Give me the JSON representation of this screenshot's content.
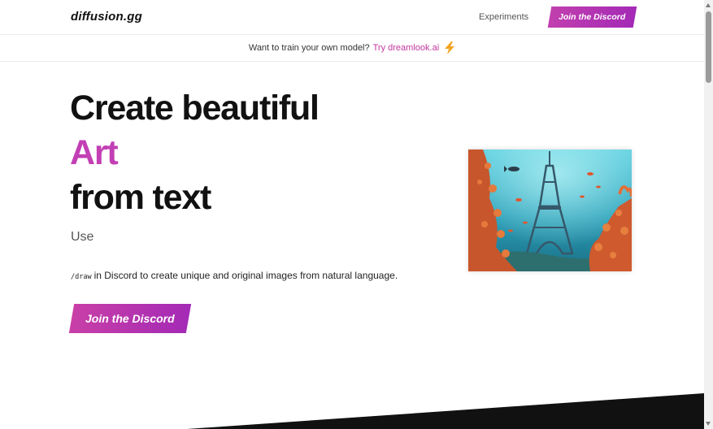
{
  "header": {
    "logo": "diffusion.gg",
    "nav_experiments": "Experiments",
    "cta": "Join the Discord"
  },
  "banner": {
    "text": "Want to train your own model?",
    "link": "Try dreamlook.ai",
    "icon": "lightning-bolt-icon"
  },
  "hero": {
    "line1": "Create beautiful",
    "line2": "Art",
    "line3": "from text",
    "use": "Use",
    "command": "/draw",
    "description": "in Discord to create unique and original images from natural language.",
    "cta": "Join the Discord"
  },
  "colors": {
    "accent": "#c23fb4",
    "link": "#c2379e",
    "text": "#111111",
    "dark": "#111111"
  }
}
